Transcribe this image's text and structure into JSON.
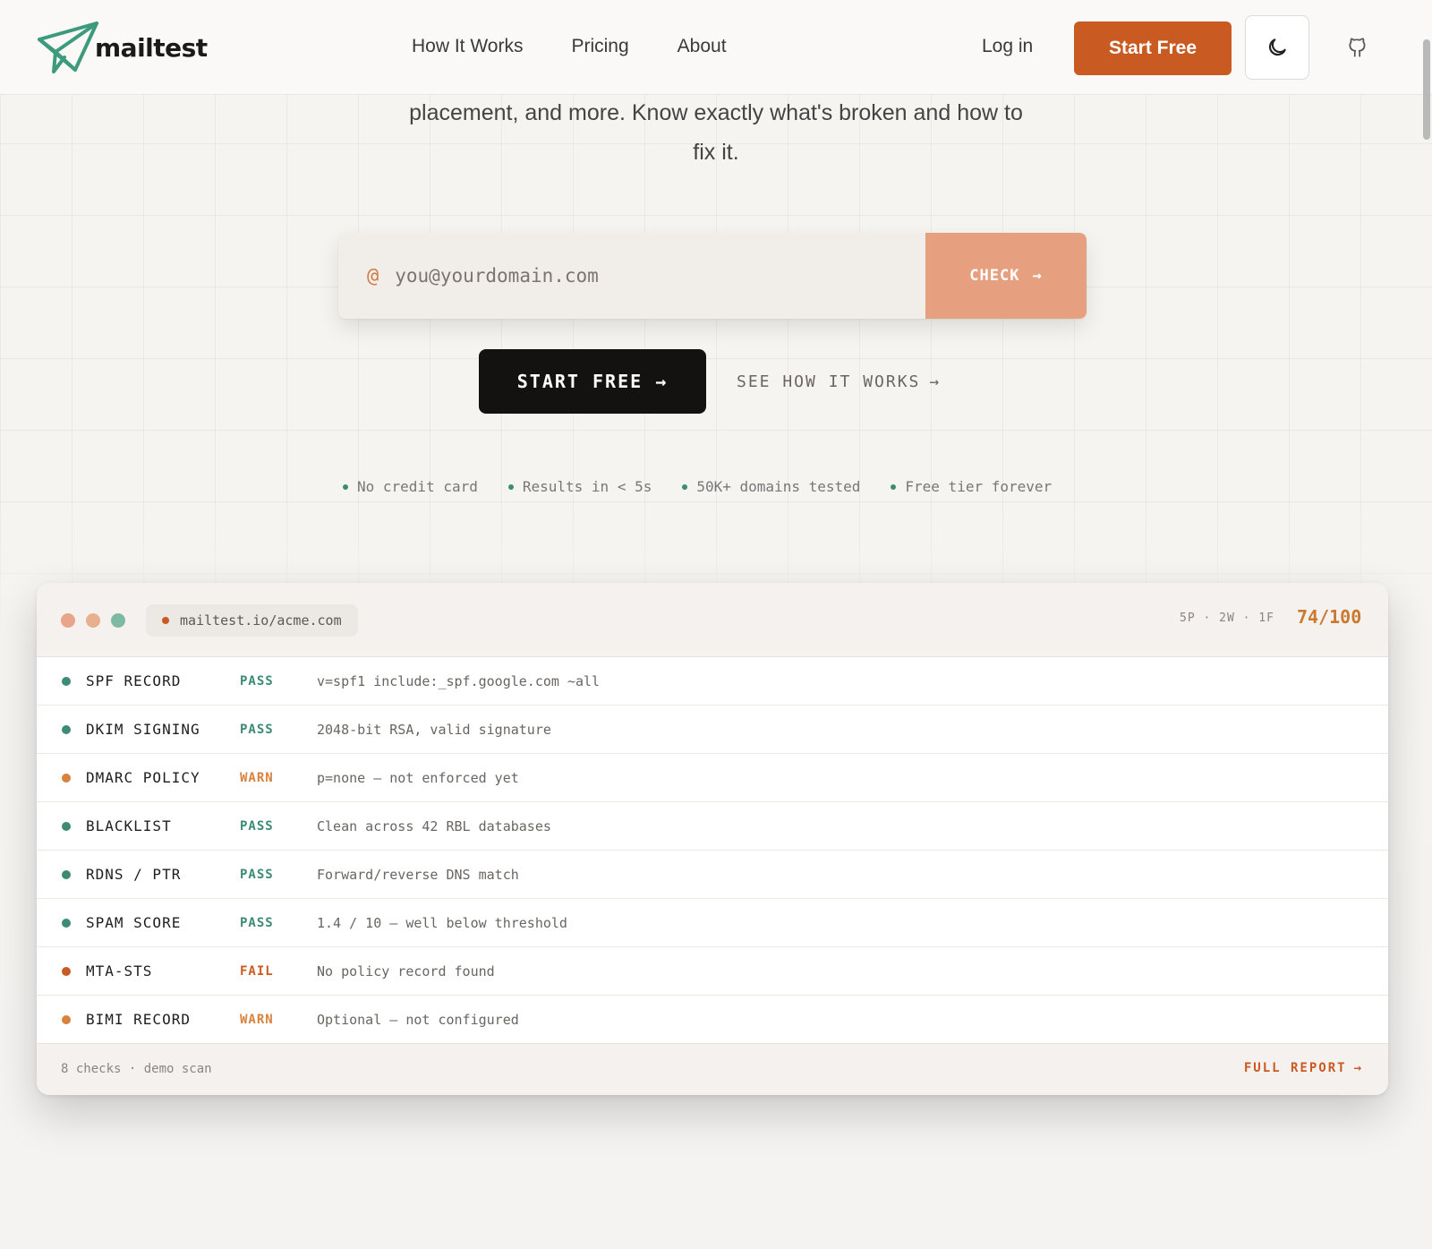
{
  "colors": {
    "accent": "#c95a22",
    "pass": "#3d8b74",
    "warn": "#d9823d",
    "fail": "#c95a22",
    "dark": "#141210"
  },
  "header": {
    "logo_text": "mailtest",
    "nav": [
      "How It Works",
      "Pricing",
      "About"
    ],
    "login_label": "Log in",
    "start_free_label": "Start Free",
    "theme_icon": "moon-icon",
    "github_icon": "github-icon"
  },
  "hero": {
    "subtitle_line1": "placement, and more. Know exactly what's broken and how to",
    "subtitle_line2": "fix it.",
    "email_placeholder": "you@yourdomain.com",
    "at_symbol": "@",
    "check_label": "CHECK",
    "start_free_label": "START FREE",
    "see_how_label": "SEE HOW IT WORKS",
    "perks": [
      "No credit card",
      "Results in < 5s",
      "50K+ domains tested",
      "Free tier forever"
    ]
  },
  "report": {
    "url": "mailtest.io/acme.com",
    "counts": "5P · 2W · 1F",
    "score": "74/100",
    "rows": [
      {
        "name": "SPF RECORD",
        "status": "PASS",
        "detail": "v=spf1 include:_spf.google.com ~all"
      },
      {
        "name": "DKIM SIGNING",
        "status": "PASS",
        "detail": "2048-bit RSA, valid signature"
      },
      {
        "name": "DMARC POLICY",
        "status": "WARN",
        "detail": "p=none — not enforced yet"
      },
      {
        "name": "BLACKLIST",
        "status": "PASS",
        "detail": "Clean across 42 RBL databases"
      },
      {
        "name": "RDNS / PTR",
        "status": "PASS",
        "detail": "Forward/reverse DNS match"
      },
      {
        "name": "SPAM SCORE",
        "status": "PASS",
        "detail": "1.4 / 10 — well below threshold"
      },
      {
        "name": "MTA-STS",
        "status": "FAIL",
        "detail": "No policy record found"
      },
      {
        "name": "BIMI RECORD",
        "status": "WARN",
        "detail": "Optional — not configured"
      }
    ],
    "footer_left": "8 checks · demo scan",
    "footer_right": "FULL REPORT"
  }
}
